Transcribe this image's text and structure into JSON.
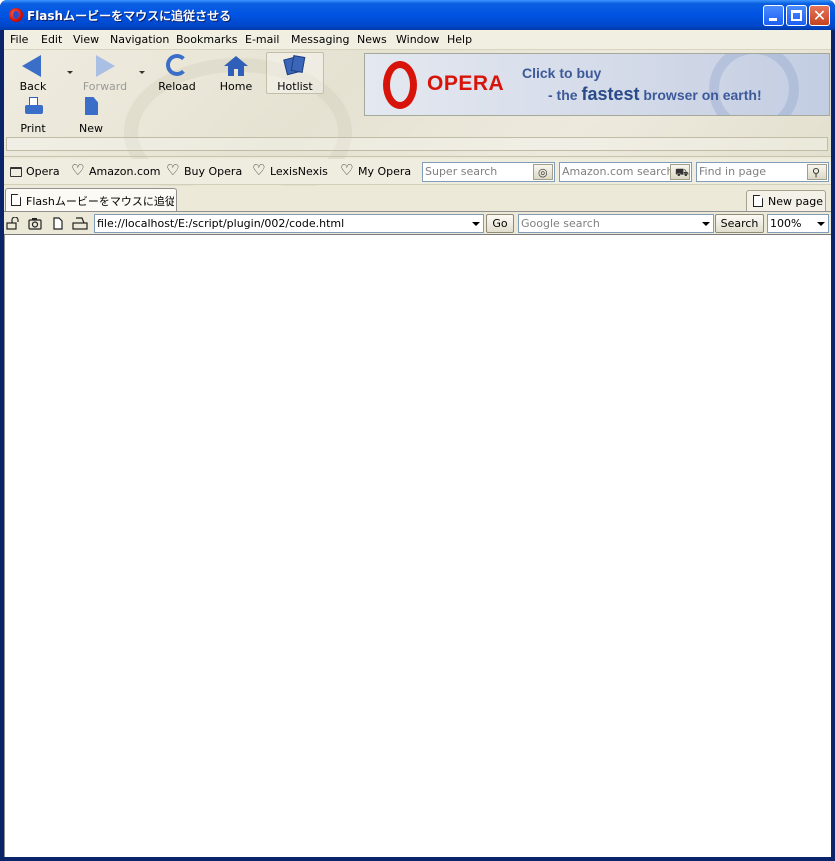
{
  "window": {
    "title": "Flashムービーをマウスに追従させる",
    "close_glyph": "✕"
  },
  "menu": [
    "File",
    "Edit",
    "View",
    "Navigation",
    "Bookmarks",
    "E-mail",
    "Messaging",
    "News",
    "Window",
    "Help"
  ],
  "toolbar": {
    "back": "Back",
    "forward": "Forward",
    "reload": "Reload",
    "home": "Home",
    "hotlist": "Hotlist",
    "print": "Print",
    "new": "New"
  },
  "ad": {
    "brand": "OPERA",
    "line1": "Click to buy",
    "line2_pre": "- the ",
    "line2_big": "fastest",
    "line2_post": " browser on earth!"
  },
  "personal_bar": {
    "items": [
      "Opera",
      "Amazon.com",
      "Buy Opera",
      "LexisNexis",
      "My Opera"
    ],
    "super_search_placeholder": "Super search",
    "amazon_search_placeholder": "Amazon.com search",
    "find_placeholder": "Find in page"
  },
  "tabs": {
    "active_label": "Flashムービーをマウスに追従さ...",
    "new_page_label": "New page"
  },
  "address_bar": {
    "url": "file://localhost/E:/script/plugin/002/code.html",
    "go_label": "Go",
    "google_placeholder": "Google search",
    "search_label": "Search",
    "zoom": "100%"
  }
}
